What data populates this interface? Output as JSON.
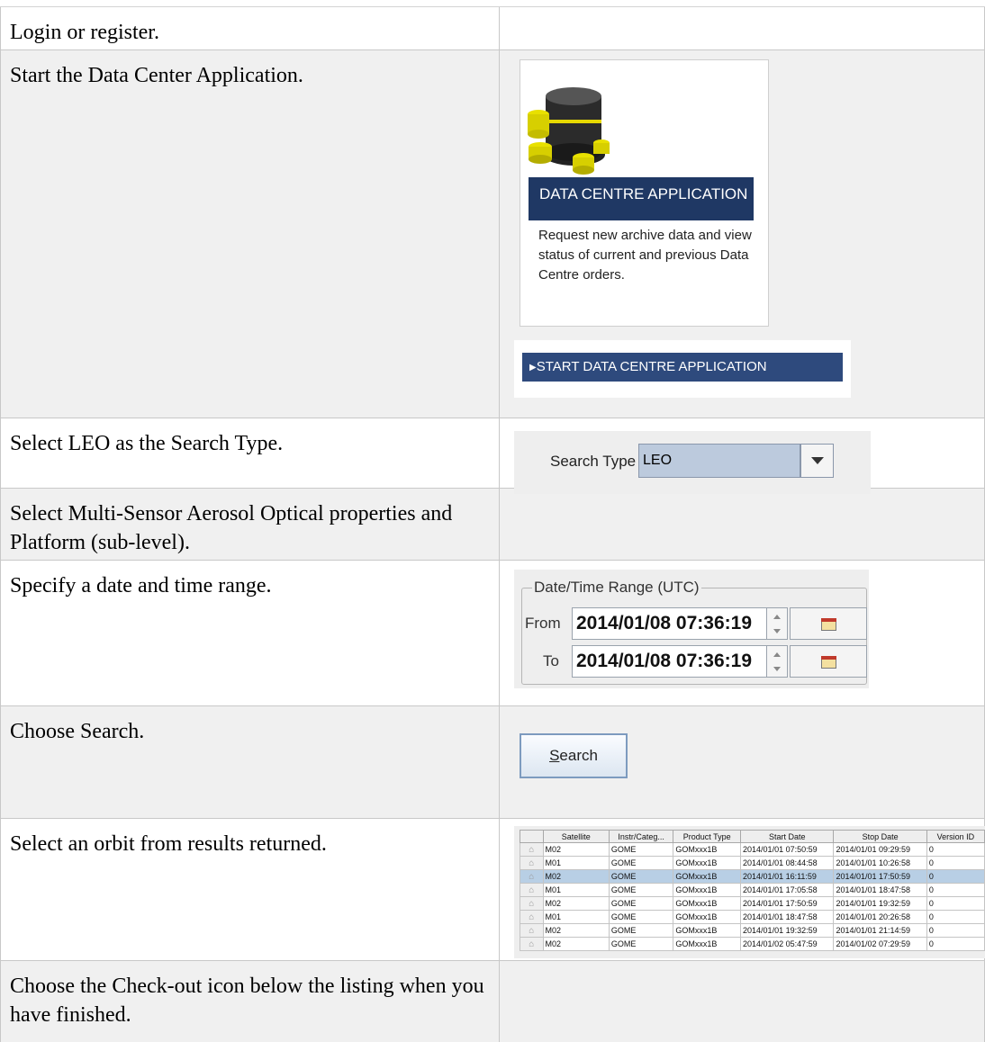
{
  "steps": [
    {
      "instruction": "Login or register."
    },
    {
      "instruction": "Start the Data Center Application."
    },
    {
      "instruction": "Select LEO as the Search Type."
    },
    {
      "instruction": "Select Multi-Sensor Aerosol Optical properties and Platform (sub-level)."
    },
    {
      "instruction": "Specify a date and time range."
    },
    {
      "instruction": "Choose Search."
    },
    {
      "instruction": "Select an orbit from results returned."
    },
    {
      "instruction": "Choose the Check-out icon below the listing when you have finished."
    }
  ],
  "data_centre_card": {
    "title": "DATA CENTRE APPLICATION",
    "description": "Request new archive data and view status of current and previous Data Centre orders.",
    "icon": "database-icon",
    "start_button": "START DATA CENTRE APPLICATION"
  },
  "search_type": {
    "label": "Search Type",
    "value": "LEO"
  },
  "date_range": {
    "legend": "Date/Time Range (UTC)",
    "from_label": "From",
    "from_value": "2014/01/08 07:36:19",
    "to_label": "To",
    "to_value": "2014/01/08 07:36:19"
  },
  "search_button": {
    "label_first": "S",
    "label_rest": "earch"
  },
  "results": {
    "columns": [
      "Satellite",
      "Instr/Categ...",
      "Product Type",
      "Start Date",
      "Stop Date",
      "Version ID"
    ],
    "rows": [
      [
        "M02",
        "GOME",
        "GOMxxx1B",
        "2014/01/01 07:50:59",
        "2014/01/01 09:29:59",
        "0"
      ],
      [
        "M01",
        "GOME",
        "GOMxxx1B",
        "2014/01/01 08:44:58",
        "2014/01/01 10:26:58",
        "0"
      ],
      [
        "M02",
        "GOME",
        "GOMxxx1B",
        "2014/01/01 16:11:59",
        "2014/01/01 17:50:59",
        "0"
      ],
      [
        "M01",
        "GOME",
        "GOMxxx1B",
        "2014/01/01 17:05:58",
        "2014/01/01 18:47:58",
        "0"
      ],
      [
        "M02",
        "GOME",
        "GOMxxx1B",
        "2014/01/01 17:50:59",
        "2014/01/01 19:32:59",
        "0"
      ],
      [
        "M01",
        "GOME",
        "GOMxxx1B",
        "2014/01/01 18:47:58",
        "2014/01/01 20:26:58",
        "0"
      ],
      [
        "M02",
        "GOME",
        "GOMxxx1B",
        "2014/01/01 19:32:59",
        "2014/01/01 21:14:59",
        "0"
      ],
      [
        "M02",
        "GOME",
        "GOMxxx1B",
        "2014/01/02 05:47:59",
        "2014/01/02 07:29:59",
        "0"
      ]
    ],
    "selected_row": 2,
    "row_icon": "cart-icon"
  }
}
